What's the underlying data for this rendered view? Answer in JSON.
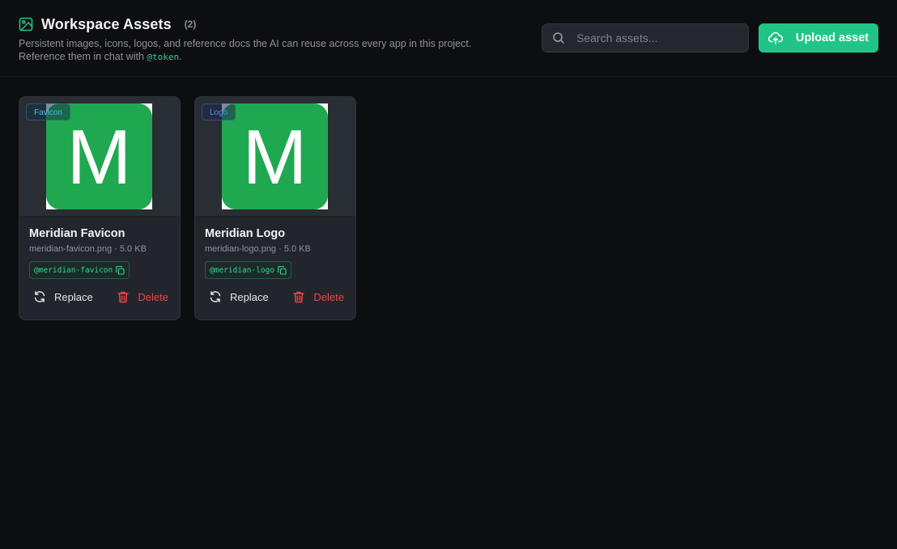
{
  "header": {
    "title": "Workspace Assets",
    "count": "(2)",
    "description": "Persistent images, icons, logos, and reference docs the AI can reuse across every app in this project.",
    "description_line2_prefix": "Reference them in chat with ",
    "token_example": "@token",
    "description_line2_suffix": "."
  },
  "search": {
    "placeholder": "Search assets..."
  },
  "upload_button": {
    "label": "Upload asset"
  },
  "assets": [
    {
      "badge": "Favicon",
      "name": "Meridian Favicon",
      "meta": "meridian-favicon.png · 5.0 KB",
      "token": "@meridian-favicon",
      "replace_label": "Replace",
      "delete_label": "Delete"
    },
    {
      "badge": "Logo",
      "name": "Meridian Logo",
      "meta": "meridian-logo.png · 5.0 KB",
      "token": "@meridian-logo",
      "replace_label": "Replace",
      "delete_label": "Delete"
    }
  ],
  "logo_glyph": "M",
  "colors": {
    "accent": "#20c487",
    "logo_green": "#1fa84f",
    "delete_red": "#ef4444",
    "token_green": "#34d399"
  },
  "icons": {
    "title": "image-icon",
    "search": "search-icon",
    "upload": "cloud-upload-icon",
    "copy": "copy-icon",
    "replace": "refresh-icon",
    "delete": "trash-icon"
  }
}
